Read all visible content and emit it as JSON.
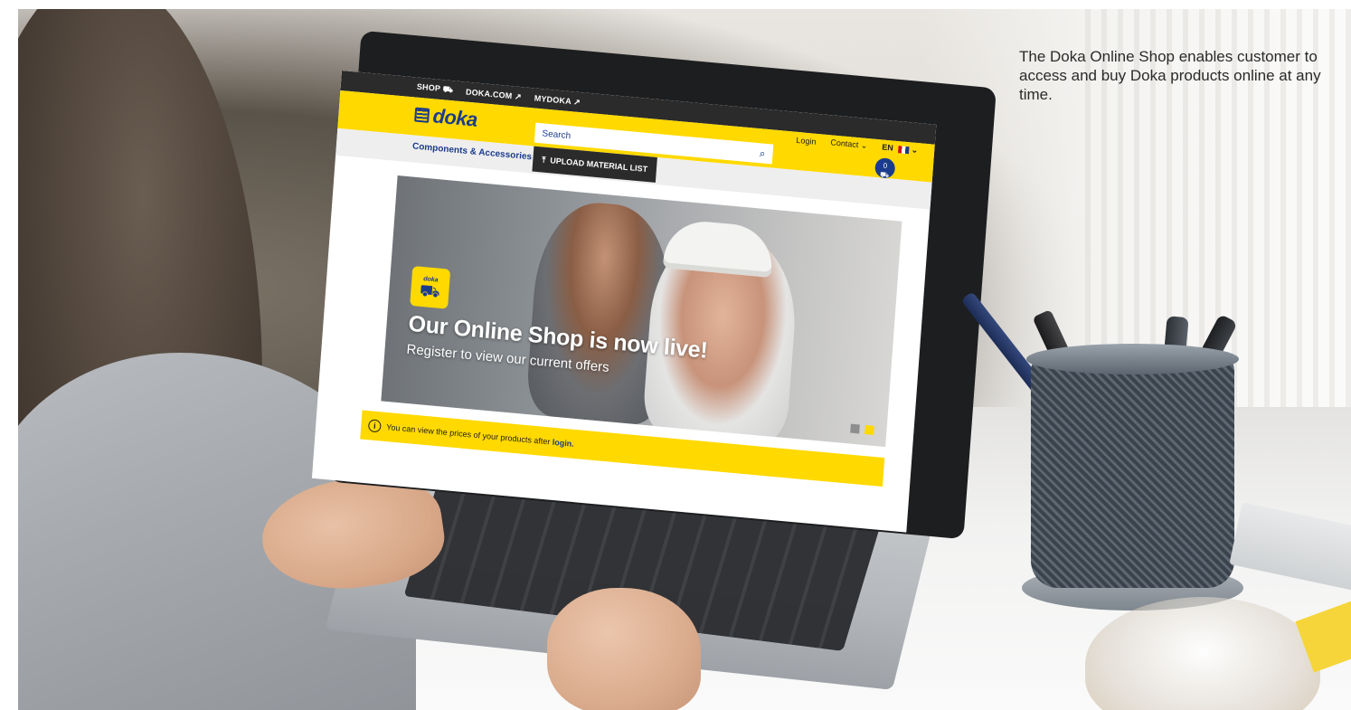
{
  "caption": "The Doka Online Shop enables customer to access and buy Doka products online at any time.",
  "website": {
    "topbar": {
      "items": [
        {
          "label": "SHOP",
          "icon": "wheelbarrow-icon",
          "active": true
        },
        {
          "label": "DOKA.COM",
          "icon": "external-link-icon",
          "active": false
        },
        {
          "label": "MYDOKA",
          "icon": "external-link-icon",
          "active": false
        }
      ]
    },
    "header": {
      "logo_text": "doka",
      "search_placeholder": "Search",
      "login_label": "Login",
      "contact_label": "Contact",
      "language_label": "EN",
      "cart_count": "0"
    },
    "nav": {
      "category_label": "Components & Accessories",
      "upload_label": "UPLOAD MATERIAL LIST"
    },
    "banner": {
      "badge_text": "doka",
      "headline": "Our Online Shop is now live!",
      "subline": "Register to view our current offers",
      "slides_total": 2,
      "slide_active": 2
    },
    "info_bar": {
      "text": "You can view the prices of your products after",
      "link_text": "login."
    },
    "colors": {
      "brand_yellow": "#ffd900",
      "brand_blue": "#1b3c8c",
      "dark_bar": "#2b2b2b"
    }
  }
}
